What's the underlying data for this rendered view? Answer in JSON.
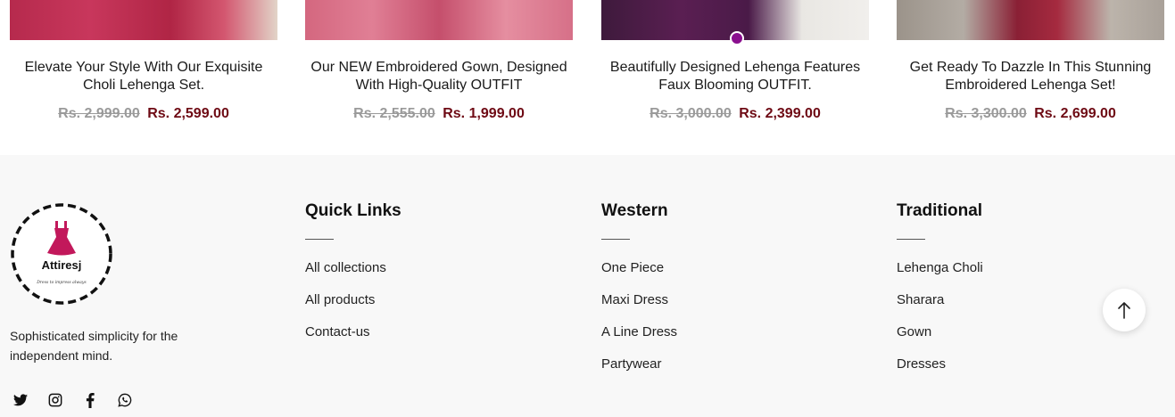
{
  "products": [
    {
      "title": "Elevate Your Style With Our Exquisite Choli Lehenga Set.",
      "old_price": "Rs. 2,999.00",
      "new_price": "Rs. 2,599.00"
    },
    {
      "title": "Our NEW Embroidered Gown, Designed With High-Quality OUTFIT",
      "old_price": "Rs. 2,555.00",
      "new_price": "Rs. 1,999.00"
    },
    {
      "title": "Beautifully Designed Lehenga Features Faux Blooming OUTFIT.",
      "old_price": "Rs. 3,000.00",
      "new_price": "Rs. 2,399.00"
    },
    {
      "title": "Get Ready To Dazzle In This Stunning Embroidered Lehenga Set!",
      "old_price": "Rs. 3,300.00",
      "new_price": "Rs. 2,699.00"
    }
  ],
  "colors": {
    "old_price": "#9a9a9a",
    "new_price": "#6e0a14",
    "footer_bg": "#f8f8f8",
    "accent_dot": "#8a0f8e",
    "logo_dress": "#c2185b"
  },
  "footer": {
    "brand": {
      "name": "Attiresj",
      "slogan": "Dress to impress always"
    },
    "tagline": "Sophisticated simplicity for the independent mind.",
    "social": [
      "twitter-icon",
      "instagram-icon",
      "facebook-icon",
      "whatsapp-icon"
    ],
    "columns": [
      {
        "heading": "Quick Links",
        "links": [
          "All collections",
          "All products",
          "Contact-us"
        ]
      },
      {
        "heading": "Western",
        "links": [
          "One Piece",
          "Maxi Dress",
          "A Line Dress",
          "Partywear"
        ]
      },
      {
        "heading": "Traditional",
        "links": [
          "Lehenga Choli",
          "Sharara",
          "Gown",
          "Dresses"
        ]
      }
    ],
    "scroll_top_icon": "arrow-up-icon"
  }
}
